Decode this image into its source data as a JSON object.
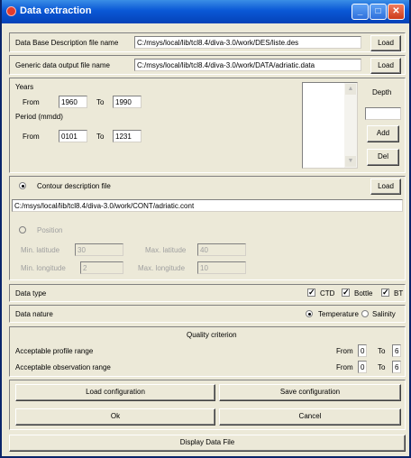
{
  "window": {
    "title": "Data extraction"
  },
  "db": {
    "label": "Data Base Description file name",
    "value": "C:/msys/local/lib/tcl8.4/diva-3.0/work/DES/liste.des",
    "load": "Load"
  },
  "out": {
    "label": "Generic data output file name",
    "value": "C:/msys/local/lib/tcl8.4/diva-3.0/work/DATA/adriatic.data",
    "load": "Load"
  },
  "years": {
    "label": "Years",
    "from_label": "From",
    "from": "1960",
    "to_label": "To",
    "to": "1990"
  },
  "period": {
    "label": "Period (mmdd)",
    "from_label": "From",
    "from": "0101",
    "to_label": "To",
    "to": "1231"
  },
  "depth": {
    "label": "Depth",
    "add": "Add",
    "del": "Del"
  },
  "contour": {
    "label": "Contour description file",
    "load": "Load",
    "path": "C:/msys/local/lib/tcl8.4/diva-3.0/work/CONT/adriatic.cont"
  },
  "position": {
    "label": "Position",
    "min_lat_label": "Min. latitude",
    "min_lat": "30",
    "max_lat_label": "Max. latitude",
    "max_lat": "40",
    "min_lon_label": "Min. longitude",
    "min_lon": "2",
    "max_lon_label": "Max. longitude",
    "max_lon": "10"
  },
  "datatype": {
    "label": "Data type",
    "ctd": "CTD",
    "bottle": "Bottle",
    "bt": "BT"
  },
  "datanature": {
    "label": "Data nature",
    "temperature": "Temperature",
    "salinity": "Salinity"
  },
  "quality": {
    "title": "Quality criterion",
    "profile_label": "Acceptable profile range",
    "profile_from_label": "From",
    "profile_from": "0",
    "profile_to_label": "To",
    "profile_to": "6",
    "obs_label": "Acceptable observation range",
    "obs_from_label": "From",
    "obs_from": "0",
    "obs_to_label": "To",
    "obs_to": "6"
  },
  "buttons": {
    "load_config": "Load configuration",
    "save_config": "Save configuration",
    "ok": "Ok",
    "cancel": "Cancel",
    "display": "Display Data File"
  }
}
